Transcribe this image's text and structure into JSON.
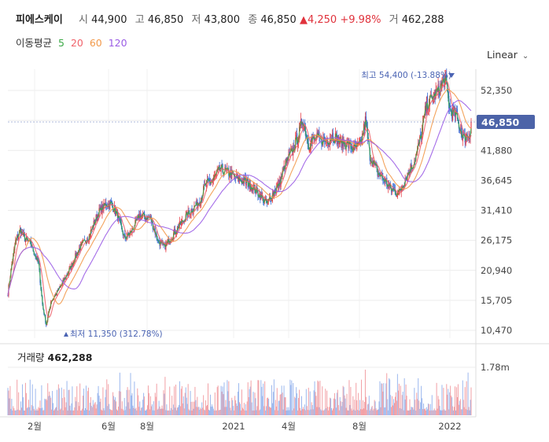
{
  "header": {
    "name": "피에스케이",
    "open_label": "시",
    "open": "44,900",
    "high_label": "고",
    "high": "46,850",
    "low_label": "저",
    "low": "43,800",
    "close_label": "종",
    "close": "46,850",
    "change": "▲4,250",
    "change_pct": "+9.98%",
    "volume_label": "거",
    "volume": "462,288"
  },
  "ma_legend": {
    "title": "이동평균",
    "periods": [
      {
        "label": "5",
        "color": "#3aa845"
      },
      {
        "label": "20",
        "color": "#f0626a"
      },
      {
        "label": "60",
        "color": "#f2994a"
      },
      {
        "label": "120",
        "color": "#9b5de5"
      }
    ]
  },
  "scale_button": {
    "label": "Linear",
    "icon": "chevron-down-icon"
  },
  "chart_data": {
    "type": "candlestick",
    "y_ticks": [
      "52,350",
      "47,115",
      "41,880",
      "36,645",
      "31,410",
      "26,175",
      "20,940",
      "15,705",
      "10,470"
    ],
    "y_range": [
      10470,
      54000
    ],
    "current_price_label": "46,850",
    "x_ticks": [
      "2월",
      "6월",
      "8월",
      "2021",
      "4월",
      "8월",
      "2022"
    ],
    "max_annotation": "최고 54,400 (-13.88%)",
    "min_annotation": "최저 11,350 (312.78%)",
    "price_keypoints": [
      [
        0,
        17000
      ],
      [
        5,
        22000
      ],
      [
        10,
        26000
      ],
      [
        16,
        28000
      ],
      [
        22,
        26500
      ],
      [
        30,
        25500
      ],
      [
        40,
        22000
      ],
      [
        45,
        15000
      ],
      [
        50,
        11350
      ],
      [
        56,
        15500
      ],
      [
        66,
        17500
      ],
      [
        80,
        21000
      ],
      [
        92,
        24500
      ],
      [
        106,
        27000
      ],
      [
        118,
        31000
      ],
      [
        128,
        32500
      ],
      [
        136,
        32500
      ],
      [
        144,
        30000
      ],
      [
        152,
        26500
      ],
      [
        160,
        27500
      ],
      [
        172,
        30500
      ],
      [
        186,
        30000
      ],
      [
        196,
        26000
      ],
      [
        204,
        25000
      ],
      [
        212,
        26500
      ],
      [
        222,
        28500
      ],
      [
        236,
        31000
      ],
      [
        250,
        33000
      ],
      [
        258,
        36000
      ],
      [
        266,
        36500
      ],
      [
        276,
        38500
      ],
      [
        288,
        38000
      ],
      [
        298,
        37000
      ],
      [
        306,
        36500
      ],
      [
        316,
        36000
      ],
      [
        326,
        34500
      ],
      [
        338,
        32500
      ],
      [
        346,
        34500
      ],
      [
        354,
        36000
      ],
      [
        362,
        39500
      ],
      [
        372,
        42000
      ],
      [
        380,
        45000
      ],
      [
        384,
        47500
      ],
      [
        392,
        43000
      ],
      [
        402,
        44000
      ],
      [
        414,
        43500
      ],
      [
        424,
        44500
      ],
      [
        432,
        43500
      ],
      [
        442,
        43000
      ],
      [
        452,
        42000
      ],
      [
        460,
        43000
      ],
      [
        466,
        47000
      ],
      [
        472,
        41000
      ],
      [
        482,
        38000
      ],
      [
        492,
        36500
      ],
      [
        500,
        35000
      ],
      [
        510,
        34500
      ],
      [
        520,
        37500
      ],
      [
        530,
        40000
      ],
      [
        538,
        44000
      ],
      [
        546,
        50000
      ],
      [
        554,
        51000
      ],
      [
        562,
        52500
      ],
      [
        570,
        54400
      ],
      [
        576,
        49000
      ],
      [
        584,
        48000
      ],
      [
        594,
        44000
      ],
      [
        604,
        45000
      ]
    ],
    "ma_periods": [
      5,
      20,
      60,
      120
    ],
    "volume_title": "거래량",
    "volume_value": "462,288",
    "volume_ticks": [
      "1.78m"
    ],
    "volume_max": 1780000
  }
}
